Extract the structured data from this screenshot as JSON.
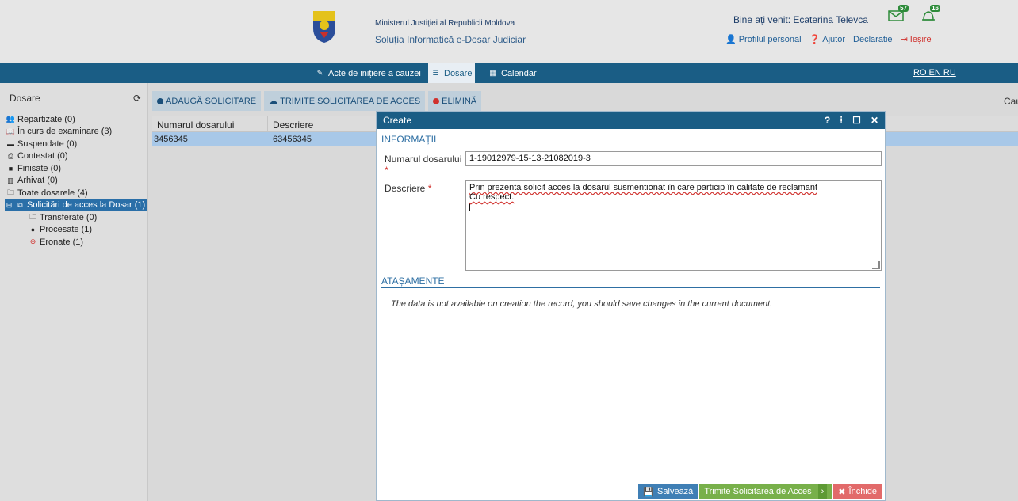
{
  "header": {
    "ministry": "Ministerul Justiției al Republicii Moldova",
    "system": "Soluția Informatică e-Dosar Judiciar",
    "welcome": "Bine ați venit: Ecaterina Televca",
    "links": {
      "profile": "Profilul personal",
      "help": "Ajutor",
      "declaration": "Declaratie",
      "logout": "Ieșire"
    },
    "notifications": {
      "mail_count": "57",
      "bell_count": "16"
    }
  },
  "nav": {
    "acte": "Acte de inițiere a cauzei",
    "dosare": "Dosare",
    "calendar": "Calendar",
    "languages": "RO EN RU"
  },
  "sidebar": {
    "title": "Dosare",
    "items": [
      {
        "label": "Repartizate (0)",
        "icon": "users-icon"
      },
      {
        "label": "În curs de examinare (3)",
        "icon": "book-icon"
      },
      {
        "label": "Suspendate (0)",
        "icon": "briefcase-icon"
      },
      {
        "label": "Contestat (0)",
        "icon": "printer-icon"
      },
      {
        "label": "Finisate (0)",
        "icon": "book-closed-icon"
      },
      {
        "label": "Arhivat (0)",
        "icon": "archive-icon"
      },
      {
        "label": "Toate dosarele (4)",
        "icon": "folder-icon"
      },
      {
        "label": "Solicitări de acces la Dosar (1)",
        "icon": "access-icon"
      },
      {
        "label": "Transferate (0)",
        "icon": "folder-icon"
      },
      {
        "label": "Procesate (1)",
        "icon": "check-icon"
      },
      {
        "label": "Eronate (1)",
        "icon": "minus-icon"
      }
    ]
  },
  "toolbar": {
    "add": "ADAUGĂ SOLICITARE",
    "send": "TRIMITE SOLICITAREA DE ACCES",
    "delete": "ELIMINĂ",
    "search_partial": "Cau"
  },
  "grid": {
    "columns": [
      "Numarul dosarului",
      "Descriere"
    ],
    "rows": [
      {
        "numar": "3456345",
        "descriere": "63456345"
      }
    ]
  },
  "modal": {
    "title": "Create",
    "controls": [
      "?",
      "⁞",
      "☐",
      "✕"
    ],
    "section_info": "INFORMAȚII",
    "label_numar": "Numarul dosarului",
    "value_numar": "1-19012979-15-13-21082019-3",
    "label_descriere": "Descriere",
    "descriere_line1": "Prin prezenta solicit acces la dosarul susmentionat în care particip în calitate de reclamant",
    "descriere_line2": "Cu respect.",
    "section_attach": "ATAȘAMENTE",
    "attach_note": "The data is not available on creation the record, you should save changes in the current document.",
    "btn_save": "Salvează",
    "btn_send": "Trimite Solicitarea de Acces",
    "btn_close": "Închide"
  },
  "colors": {
    "navbar": "#1a5d85",
    "accent": "#2e6fa3",
    "save": "#3f7fb5",
    "send": "#78b04a",
    "close": "#e26a6a"
  }
}
